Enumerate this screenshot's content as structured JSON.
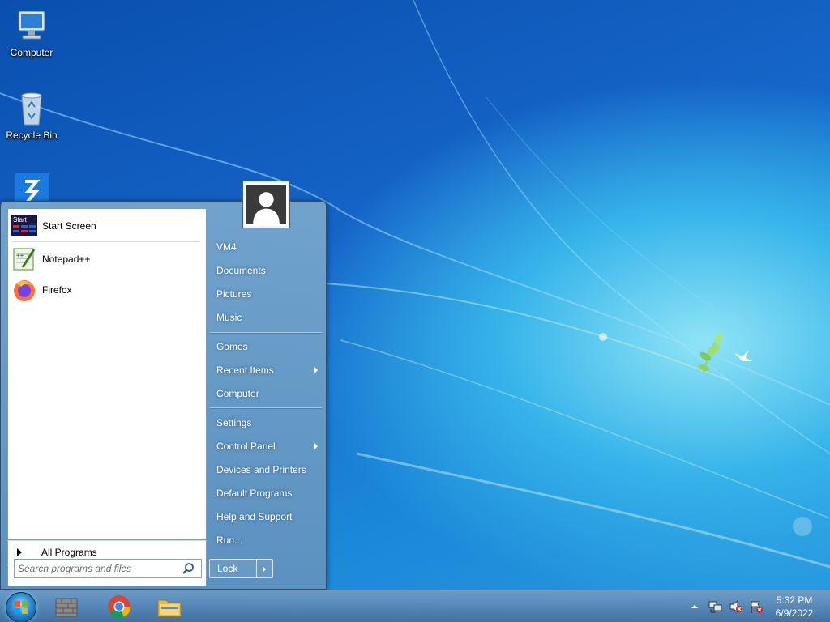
{
  "desktop": {
    "icons": [
      {
        "label": "Computer",
        "icon": "computer-icon"
      },
      {
        "label": "Recycle Bin",
        "icon": "recycle-bin-icon"
      },
      {
        "label": "",
        "icon": "zoom-app-icon"
      }
    ]
  },
  "start_menu": {
    "pinned": [
      {
        "label": "Start Screen",
        "icon": "start-screen-icon"
      },
      {
        "label": "Notepad++",
        "icon": "notepadpp-icon"
      },
      {
        "label": "Firefox",
        "icon": "firefox-icon"
      }
    ],
    "all_programs_label": "All Programs",
    "search_placeholder": "Search programs and files",
    "user_icon": "user-avatar-icon",
    "right_items": [
      {
        "label": "VM4",
        "submenu": false
      },
      {
        "label": "Documents",
        "submenu": false
      },
      {
        "label": "Pictures",
        "submenu": false
      },
      {
        "label": "Music",
        "submenu": false
      },
      {
        "label": "Games",
        "submenu": false
      },
      {
        "label": "Recent Items",
        "submenu": true
      },
      {
        "label": "Computer",
        "submenu": false
      },
      {
        "label": "Settings",
        "submenu": false
      },
      {
        "label": "Control Panel",
        "submenu": true
      },
      {
        "label": "Devices and Printers",
        "submenu": false
      },
      {
        "label": "Default Programs",
        "submenu": false
      },
      {
        "label": "Help and Support",
        "submenu": false
      },
      {
        "label": "Run...",
        "submenu": false
      }
    ],
    "lock_label": "Lock"
  },
  "taskbar": {
    "start_icon": "windows-orb-icon",
    "apps": [
      "classic-start-icon",
      "chrome-icon",
      "file-explorer-icon"
    ],
    "tray_icons": [
      "show-hidden-icons-icon",
      "network-icon",
      "volume-muted-icon",
      "action-center-icon"
    ],
    "time": "5:32 PM",
    "date": "6/9/2022"
  },
  "colors": {
    "accent": "#1a86d8",
    "start_menu_bg": "#6e9fc8"
  }
}
